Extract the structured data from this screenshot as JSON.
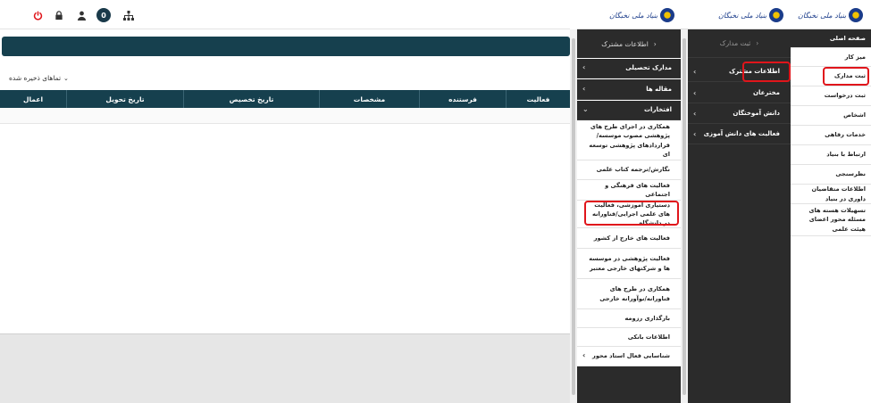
{
  "topbar": {
    "counter": "0",
    "colors": {
      "power": "#e0151b",
      "dark": "#1a3a4a"
    }
  },
  "main": {
    "saved_filter_label": "تماهای ذخیره شده",
    "grid_columns": [
      "فعالیت",
      "فرستنده",
      "مشخصات",
      "تاریخ تخصیص",
      "تاریخ تحویل",
      "اعمال"
    ]
  },
  "logo": {
    "text": "بنیاد ملی نخبگان"
  },
  "panel1": {
    "header": "اطلاعات مشترک",
    "items": [
      {
        "label": "مدارک تحصیلی"
      },
      {
        "label": "مقاله ها"
      },
      {
        "label": "افتخارات"
      },
      {
        "label": "همکاری در اجرای طرح های پژوهشی مصوب موسسه/قراردادهای پژوهشی توسعه ای"
      },
      {
        "label": "نگارش/ترجمه کتاب علمی"
      },
      {
        "label": "فعالیت های فرهنگی و اجتماعی"
      },
      {
        "label": "دستیاری آموزشی، فعالیت های علمی اجرایی/فناورانه در دانشگاه"
      },
      {
        "label": "فعالیت های خارج از کشور"
      },
      {
        "label": "فعالیت پژوهشی در موسسه ها و شرکتهای خارجی معتبر"
      },
      {
        "label": "همکاری در طرح های فناورانه/نوآورانه خارجی"
      },
      {
        "label": "بارگذاری رزومه"
      },
      {
        "label": "اطلاعات بانکی"
      },
      {
        "label": "شناسایی فعال استاد محور"
      }
    ]
  },
  "panel2": {
    "header": "ثبت مدارک",
    "items": [
      {
        "label": "اطلاعات مشترک"
      },
      {
        "label": "مخترعان"
      },
      {
        "label": "دانش آموختگان"
      },
      {
        "label": "فعالیت های دانش آموزی"
      }
    ]
  },
  "panel3": {
    "items": [
      {
        "label": "صفحه اصلی"
      },
      {
        "label": "میز کار"
      },
      {
        "label": "ثبت مدارک"
      },
      {
        "label": "ثبت درخواست"
      },
      {
        "label": "اشخاص"
      },
      {
        "label": "خدمات رفاهی"
      },
      {
        "label": "ارتباط با بنیاد"
      },
      {
        "label": "نظرسنجی"
      },
      {
        "label": "اطلاعات متقاضیان داوری در بنیاد"
      },
      {
        "label": "تسهیلات هسته های مسئله محور اعضای هیئت علمی"
      }
    ]
  }
}
